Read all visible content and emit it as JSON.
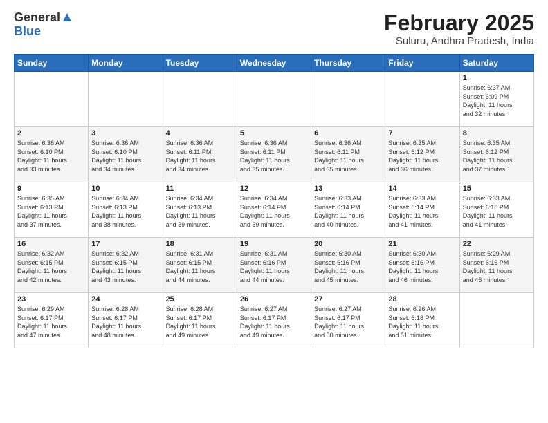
{
  "logo": {
    "general": "General",
    "blue": "Blue"
  },
  "title": "February 2025",
  "subtitle": "Suluru, Andhra Pradesh, India",
  "days_of_week": [
    "Sunday",
    "Monday",
    "Tuesday",
    "Wednesday",
    "Thursday",
    "Friday",
    "Saturday"
  ],
  "weeks": [
    [
      {
        "day": "",
        "info": ""
      },
      {
        "day": "",
        "info": ""
      },
      {
        "day": "",
        "info": ""
      },
      {
        "day": "",
        "info": ""
      },
      {
        "day": "",
        "info": ""
      },
      {
        "day": "",
        "info": ""
      },
      {
        "day": "1",
        "info": "Sunrise: 6:37 AM\nSunset: 6:09 PM\nDaylight: 11 hours\nand 32 minutes."
      }
    ],
    [
      {
        "day": "2",
        "info": "Sunrise: 6:36 AM\nSunset: 6:10 PM\nDaylight: 11 hours\nand 33 minutes."
      },
      {
        "day": "3",
        "info": "Sunrise: 6:36 AM\nSunset: 6:10 PM\nDaylight: 11 hours\nand 34 minutes."
      },
      {
        "day": "4",
        "info": "Sunrise: 6:36 AM\nSunset: 6:11 PM\nDaylight: 11 hours\nand 34 minutes."
      },
      {
        "day": "5",
        "info": "Sunrise: 6:36 AM\nSunset: 6:11 PM\nDaylight: 11 hours\nand 35 minutes."
      },
      {
        "day": "6",
        "info": "Sunrise: 6:36 AM\nSunset: 6:11 PM\nDaylight: 11 hours\nand 35 minutes."
      },
      {
        "day": "7",
        "info": "Sunrise: 6:35 AM\nSunset: 6:12 PM\nDaylight: 11 hours\nand 36 minutes."
      },
      {
        "day": "8",
        "info": "Sunrise: 6:35 AM\nSunset: 6:12 PM\nDaylight: 11 hours\nand 37 minutes."
      }
    ],
    [
      {
        "day": "9",
        "info": "Sunrise: 6:35 AM\nSunset: 6:13 PM\nDaylight: 11 hours\nand 37 minutes."
      },
      {
        "day": "10",
        "info": "Sunrise: 6:34 AM\nSunset: 6:13 PM\nDaylight: 11 hours\nand 38 minutes."
      },
      {
        "day": "11",
        "info": "Sunrise: 6:34 AM\nSunset: 6:13 PM\nDaylight: 11 hours\nand 39 minutes."
      },
      {
        "day": "12",
        "info": "Sunrise: 6:34 AM\nSunset: 6:14 PM\nDaylight: 11 hours\nand 39 minutes."
      },
      {
        "day": "13",
        "info": "Sunrise: 6:33 AM\nSunset: 6:14 PM\nDaylight: 11 hours\nand 40 minutes."
      },
      {
        "day": "14",
        "info": "Sunrise: 6:33 AM\nSunset: 6:14 PM\nDaylight: 11 hours\nand 41 minutes."
      },
      {
        "day": "15",
        "info": "Sunrise: 6:33 AM\nSunset: 6:15 PM\nDaylight: 11 hours\nand 41 minutes."
      }
    ],
    [
      {
        "day": "16",
        "info": "Sunrise: 6:32 AM\nSunset: 6:15 PM\nDaylight: 11 hours\nand 42 minutes."
      },
      {
        "day": "17",
        "info": "Sunrise: 6:32 AM\nSunset: 6:15 PM\nDaylight: 11 hours\nand 43 minutes."
      },
      {
        "day": "18",
        "info": "Sunrise: 6:31 AM\nSunset: 6:15 PM\nDaylight: 11 hours\nand 44 minutes."
      },
      {
        "day": "19",
        "info": "Sunrise: 6:31 AM\nSunset: 6:16 PM\nDaylight: 11 hours\nand 44 minutes."
      },
      {
        "day": "20",
        "info": "Sunrise: 6:30 AM\nSunset: 6:16 PM\nDaylight: 11 hours\nand 45 minutes."
      },
      {
        "day": "21",
        "info": "Sunrise: 6:30 AM\nSunset: 6:16 PM\nDaylight: 11 hours\nand 46 minutes."
      },
      {
        "day": "22",
        "info": "Sunrise: 6:29 AM\nSunset: 6:16 PM\nDaylight: 11 hours\nand 46 minutes."
      }
    ],
    [
      {
        "day": "23",
        "info": "Sunrise: 6:29 AM\nSunset: 6:17 PM\nDaylight: 11 hours\nand 47 minutes."
      },
      {
        "day": "24",
        "info": "Sunrise: 6:28 AM\nSunset: 6:17 PM\nDaylight: 11 hours\nand 48 minutes."
      },
      {
        "day": "25",
        "info": "Sunrise: 6:28 AM\nSunset: 6:17 PM\nDaylight: 11 hours\nand 49 minutes."
      },
      {
        "day": "26",
        "info": "Sunrise: 6:27 AM\nSunset: 6:17 PM\nDaylight: 11 hours\nand 49 minutes."
      },
      {
        "day": "27",
        "info": "Sunrise: 6:27 AM\nSunset: 6:17 PM\nDaylight: 11 hours\nand 50 minutes."
      },
      {
        "day": "28",
        "info": "Sunrise: 6:26 AM\nSunset: 6:18 PM\nDaylight: 11 hours\nand 51 minutes."
      },
      {
        "day": "",
        "info": ""
      }
    ]
  ]
}
